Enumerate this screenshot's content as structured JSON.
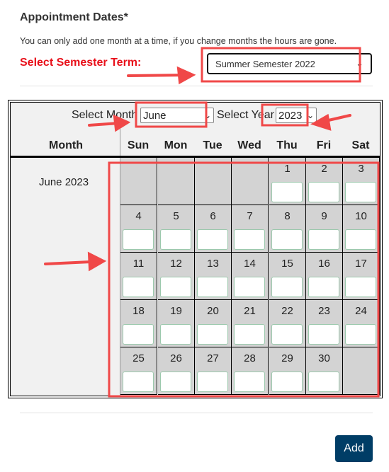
{
  "section": {
    "title": "Appointment Dates*",
    "note": "You can only add one month at a time, if you change months the hours are gone."
  },
  "term": {
    "label": "Select Semester Term:",
    "selected": "Summer Semester 2022"
  },
  "calendar": {
    "month_label": "Select Month",
    "month_selected": "June",
    "year_label": "Select Year",
    "year_selected": "2023",
    "month_col_header": "Month",
    "row_label": "June 2023",
    "weekdays": [
      "Sun",
      "Mon",
      "Tue",
      "Wed",
      "Thu",
      "Fri",
      "Sat"
    ],
    "weeks": [
      [
        "",
        "",
        "",
        "",
        "1",
        "2",
        "3"
      ],
      [
        "4",
        "5",
        "6",
        "7",
        "8",
        "9",
        "10"
      ],
      [
        "11",
        "12",
        "13",
        "14",
        "15",
        "16",
        "17"
      ],
      [
        "18",
        "19",
        "20",
        "21",
        "22",
        "23",
        "24"
      ],
      [
        "25",
        "26",
        "27",
        "28",
        "29",
        "30",
        ""
      ]
    ]
  },
  "actions": {
    "add_label": "Add"
  },
  "colors": {
    "annotation": "#f04848",
    "accent": "#003d66",
    "label_red": "#e8101a"
  }
}
